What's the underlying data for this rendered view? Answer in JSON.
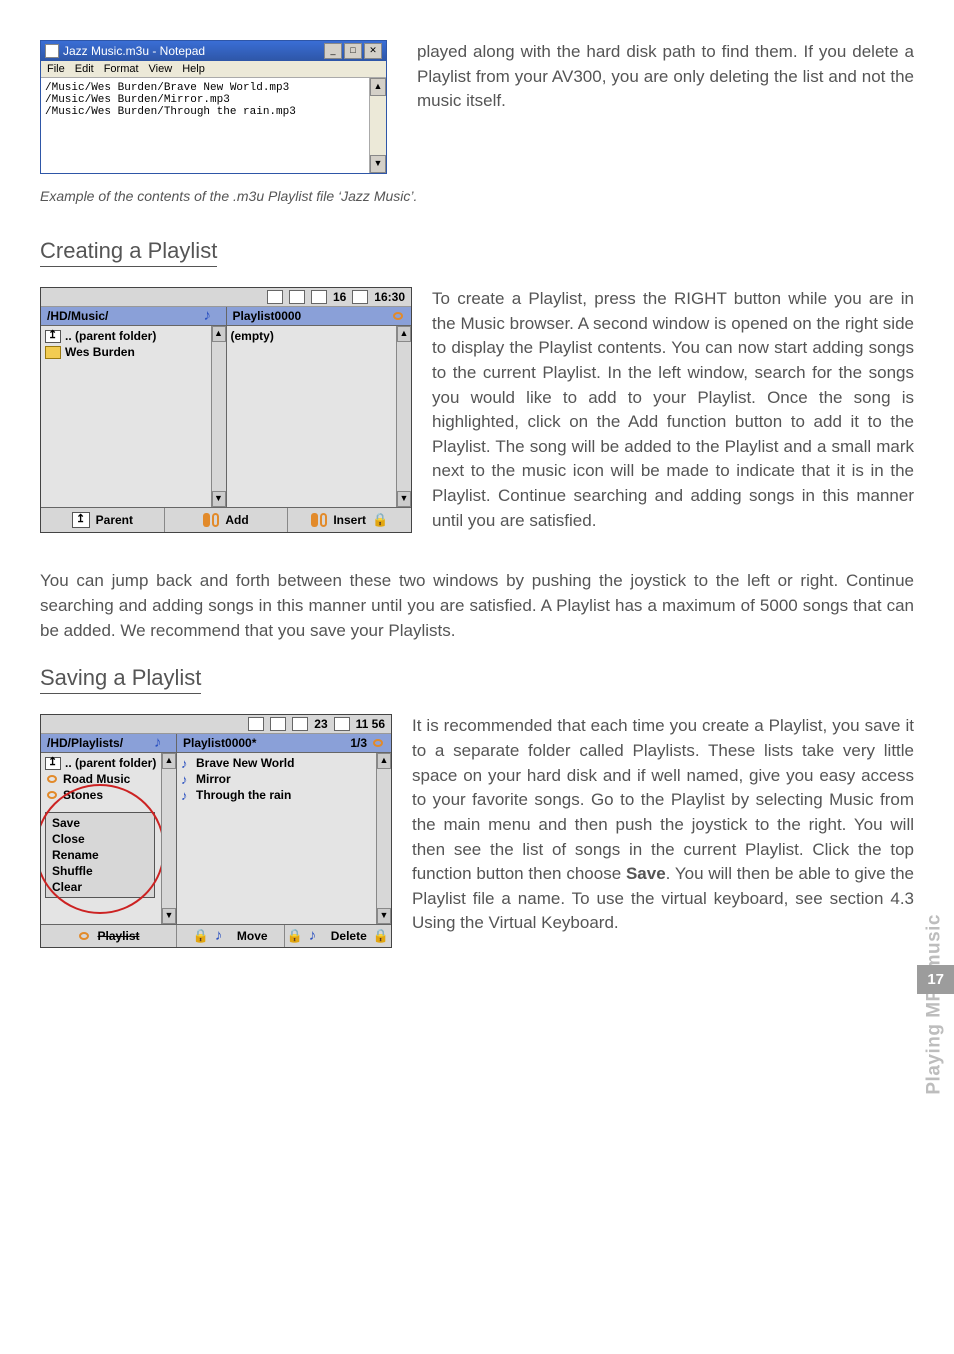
{
  "notepad": {
    "title": "Jazz Music.m3u - Notepad",
    "menus": [
      "File",
      "Edit",
      "Format",
      "View",
      "Help"
    ],
    "lines": [
      "/Music/Wes Burden/Brave New World.mp3",
      "/Music/Wes Burden/Mirror.mp3",
      "/Music/Wes Burden/Through the rain.mp3"
    ],
    "win_btns": [
      "_",
      "□",
      "✕"
    ]
  },
  "top_paragraph": "played along with the hard disk path to find them. If you delete a Playlist from your AV300, you are only deleting the list and not the music itself.",
  "caption": "Example of the contents of the .m3u Playlist file ‘Jazz Music’.",
  "section1_title": "Creating a Playlist",
  "device1": {
    "status_icons": 3,
    "status_count": "16",
    "status_time": "16:30",
    "left_title": "/HD/Music/",
    "left_items": [
      {
        "icon": "up",
        "label": ".. (parent folder)"
      },
      {
        "icon": "folder",
        "label": "Wes Burden"
      }
    ],
    "right_title": "Playlist0000",
    "right_items": [
      {
        "icon": "",
        "label": "(empty)"
      }
    ],
    "footer_left": "Parent",
    "footer_mid": "Add",
    "footer_right": "Insert"
  },
  "create_para1": "To create a Playlist, press the RIGHT button while you are in the Music browser. A second window is opened on the right side to display the Playlist contents. You can now start adding songs to the current Playlist. In the left window, search for the songs you would like to add to your Playlist. Once the song is highlighted, click on the Add function button to add it to the Playlist. The song will be added to the Playlist and a small mark next to the music icon will be made to indicate that it is in the Playlist. Continue searching and adding songs in this manner until you are satisfied.",
  "create_para2": "You can jump back and forth between these two windows by pushing the joystick to the left or right. Continue searching and adding songs in this manner until you are satisfied. A Playlist has a maximum of 5000 songs that can be added. We recommend that you save your Playlists.",
  "section2_title": "Saving a Playlist",
  "device2": {
    "status_count": "23",
    "status_time": "11 56",
    "left_title": "/HD/Playlists/",
    "left_items": [
      {
        "icon": "up",
        "label": ".. (parent folder)"
      },
      {
        "icon": "pl",
        "label": "Road Music"
      },
      {
        "icon": "pl",
        "label": "Stones"
      }
    ],
    "right_title": "Playlist0000*",
    "right_count": "1/3",
    "right_items": [
      {
        "icon": "note",
        "label": "Brave New World"
      },
      {
        "icon": "note",
        "label": "Mirror"
      },
      {
        "icon": "note",
        "label": "Through the rain"
      }
    ],
    "menu": [
      "Save",
      "Close",
      "Rename",
      "Shuffle",
      "Clear"
    ],
    "footer_left": "Playlist",
    "footer_mid": "Move",
    "footer_right": "Delete"
  },
  "save_para_pre": "It is recommended that each time you create a Playlist, you save it to a separate folder called Playlists. These lists take very little space on your hard disk and if well named, give you easy access to your favorite songs. Go to the Playlist by selecting Music from the main menu and then push the joystick to the right. You will then see the list of songs in the current Playlist. Click the top function button then choose ",
  "save_bold": "Save",
  "save_para_post": ". You will then be able to give the Playlist file a name. To use the virtual keyboard, see section 4.3 Using the Virtual Keyboard.",
  "side_label": "Playing MP3 music",
  "page_number": "17"
}
